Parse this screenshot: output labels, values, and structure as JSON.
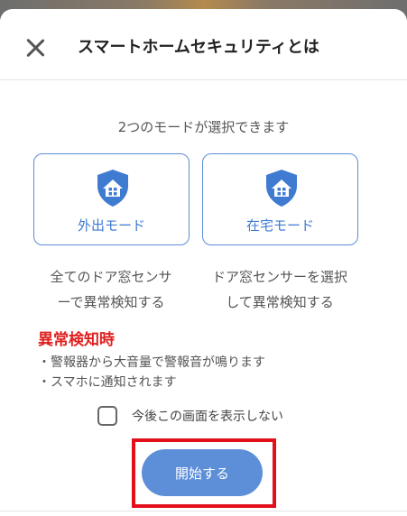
{
  "header": {
    "title": "スマートホームセキュリティとは",
    "close_icon": "close-icon"
  },
  "subtitle": "2つのモードが選択できます",
  "modes": [
    {
      "icon": "house-shield-icon",
      "label": "外出モード",
      "description_line1": "全てのドア窓センサ",
      "description_line2": "ーで異常検知する"
    },
    {
      "icon": "house-shield-icon",
      "label": "在宅モード",
      "description_line1": "ドア窓センサーを選択",
      "description_line2": "して異常検知する"
    }
  ],
  "alert": {
    "heading": "異常検知時",
    "items": [
      "・警報器から大音量で警報音が鳴ります",
      "・スマホに通知されます"
    ]
  },
  "dont_show_again": {
    "label": "今後この画面を表示しない",
    "checked": false
  },
  "start_button": {
    "label": "開始する"
  },
  "colors": {
    "accent": "#5d8fd9",
    "alert": "#e02020",
    "highlight_box": "#e3101b"
  }
}
